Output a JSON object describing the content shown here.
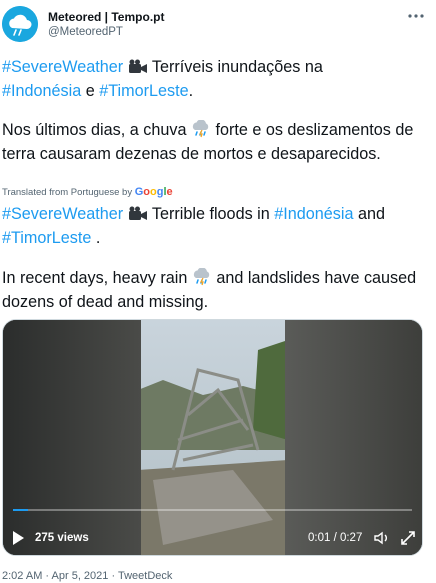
{
  "author": {
    "name": "Meteored | Tempo.pt",
    "handle": "@MeteoredPT",
    "avatar_icon": "cloud-logo-icon",
    "avatar_color": "#1aa7df"
  },
  "more_icon": "more-dots-icon",
  "original": {
    "tag_severe": "#SevereWeather",
    "pt_text1": " Terríveis inundações na",
    "tag_indonesia": "#Indonésia",
    "conj_e": " e ",
    "tag_timor": "#TimorLeste",
    "period": ".",
    "pt_body_a": "Nos últimos dias, a chuva",
    "pt_body_b": " forte e os deslizamentos de terra causaram dezenas de mortos e desaparecidos."
  },
  "translated_note": "Translated from Portuguese by",
  "translated_brand": [
    "G",
    "o",
    "o",
    "g",
    "l",
    "e"
  ],
  "translation": {
    "tag_severe": "#SevereWeather",
    "en_text1": " Terrible floods in ",
    "tag_indonesia": "#Indonésia",
    "conj_and": " and",
    "tag_timor": "#TimorLeste",
    "end": " .",
    "en_body_a": " In recent days, heavy rain",
    "en_body_b": " and landslides have caused dozens of dead and missing."
  },
  "video": {
    "views": "275 views",
    "time": "0:01 / 0:27",
    "progress": 0.037,
    "play_icon": "play-icon",
    "volume_icon": "volume-icon",
    "fullscreen_icon": "fullscreen-icon"
  },
  "meta": {
    "timestamp": "2:02 AM · Apr 5, 2021 · TweetDeck"
  },
  "colors": {
    "link": "#1d9bf0",
    "text": "#0f1419",
    "secondary": "#536471"
  }
}
